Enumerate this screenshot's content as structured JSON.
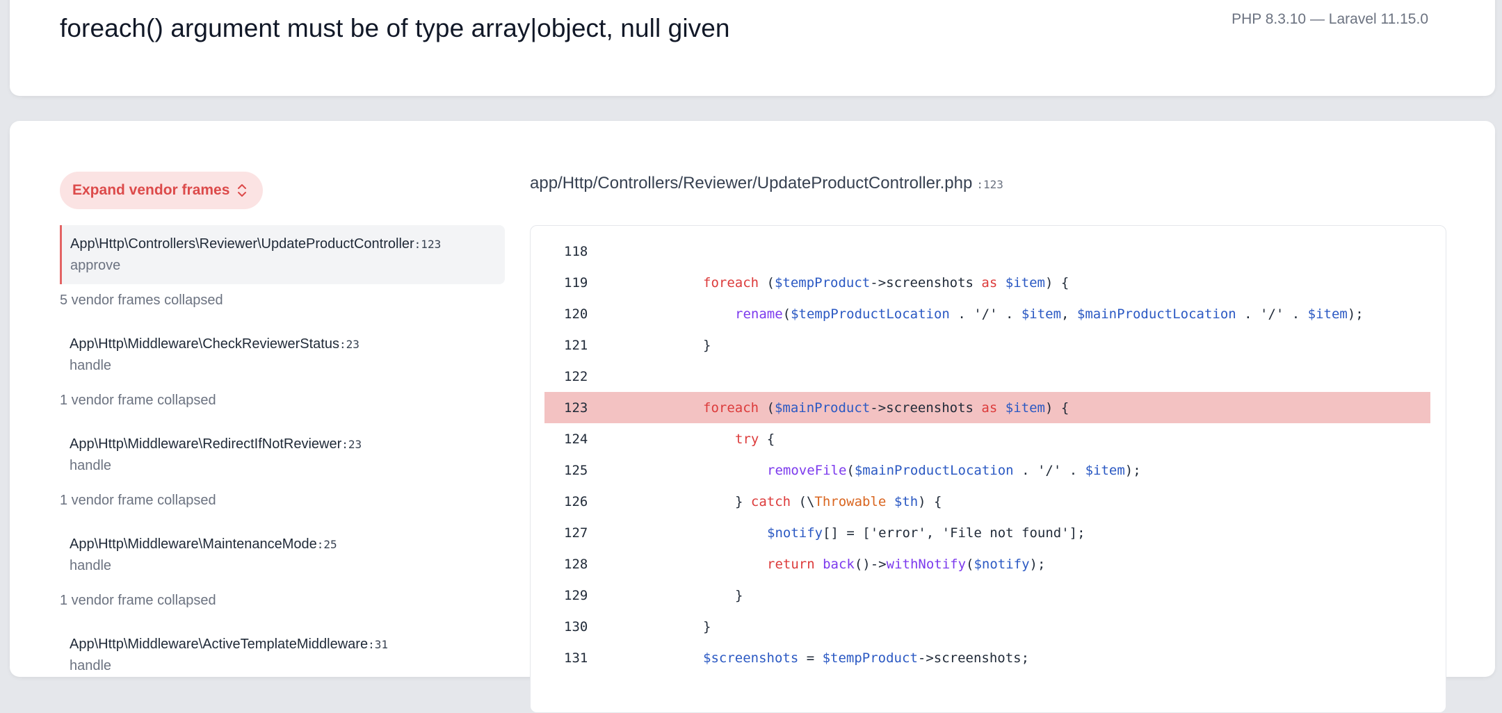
{
  "header": {
    "error_message": "foreach() argument must be of type array|object, null given",
    "version": "PHP 8.3.10 — Laravel 11.15.0"
  },
  "sidebar": {
    "expand_label": "Expand vendor frames",
    "frames": [
      {
        "class": "App\\Http\\Controllers\\Reviewer\\UpdateProductController",
        "line": ":123",
        "method": "approve",
        "active": true,
        "collapsed_after": "5 vendor frames collapsed"
      },
      {
        "class": "App\\Http\\Middleware\\CheckReviewerStatus",
        "line": ":23",
        "method": "handle",
        "collapsed_after": "1 vendor frame collapsed"
      },
      {
        "class": "App\\Http\\Middleware\\RedirectIfNotReviewer",
        "line": ":23",
        "method": "handle",
        "collapsed_after": "1 vendor frame collapsed"
      },
      {
        "class": "App\\Http\\Middleware\\MaintenanceMode",
        "line": ":25",
        "method": "handle",
        "collapsed_after": "1 vendor frame collapsed"
      },
      {
        "class": "App\\Http\\Middleware\\ActiveTemplateMiddleware",
        "line": ":31",
        "method": "handle"
      }
    ]
  },
  "editor": {
    "file_path": "app/Http/Controllers/Reviewer/UpdateProductController.php",
    "file_line": ":123",
    "highlight_line": "123",
    "lines": [
      {
        "num": "118",
        "indent": 0,
        "tokens": []
      },
      {
        "num": "119",
        "indent": 0,
        "tokens": [
          [
            "kw",
            "foreach"
          ],
          [
            "p",
            " ("
          ],
          [
            "var",
            "$tempProduct"
          ],
          [
            "p",
            "->screenshots "
          ],
          [
            "kw",
            "as"
          ],
          [
            "p",
            " "
          ],
          [
            "var",
            "$item"
          ],
          [
            "p",
            ") {"
          ]
        ]
      },
      {
        "num": "120",
        "indent": 1,
        "tokens": [
          [
            "fn",
            "rename"
          ],
          [
            "p",
            "("
          ],
          [
            "var",
            "$tempProductLocation"
          ],
          [
            "p",
            " . '/' . "
          ],
          [
            "var",
            "$item"
          ],
          [
            "p",
            ", "
          ],
          [
            "var",
            "$mainProductLocation"
          ],
          [
            "p",
            " . '/' . "
          ],
          [
            "var",
            "$item"
          ],
          [
            "p",
            ");"
          ]
        ]
      },
      {
        "num": "121",
        "indent": 0,
        "tokens": [
          [
            "p",
            "}"
          ]
        ]
      },
      {
        "num": "122",
        "indent": 0,
        "tokens": []
      },
      {
        "num": "123",
        "indent": 0,
        "tokens": [
          [
            "kw",
            "foreach"
          ],
          [
            "p",
            " ("
          ],
          [
            "var",
            "$mainProduct"
          ],
          [
            "p",
            "->screenshots "
          ],
          [
            "kw",
            "as"
          ],
          [
            "p",
            " "
          ],
          [
            "var",
            "$item"
          ],
          [
            "p",
            ") {"
          ]
        ]
      },
      {
        "num": "124",
        "indent": 1,
        "tokens": [
          [
            "kw",
            "try"
          ],
          [
            "p",
            " {"
          ]
        ]
      },
      {
        "num": "125",
        "indent": 2,
        "tokens": [
          [
            "fn",
            "removeFile"
          ],
          [
            "p",
            "("
          ],
          [
            "var",
            "$mainProductLocation"
          ],
          [
            "p",
            " . '/' . "
          ],
          [
            "var",
            "$item"
          ],
          [
            "p",
            ");"
          ]
        ]
      },
      {
        "num": "126",
        "indent": 1,
        "tokens": [
          [
            "p",
            "} "
          ],
          [
            "kw",
            "catch"
          ],
          [
            "p",
            " (\\"
          ],
          [
            "cls",
            "Throwable"
          ],
          [
            "p",
            " "
          ],
          [
            "var",
            "$th"
          ],
          [
            "p",
            ") {"
          ]
        ]
      },
      {
        "num": "127",
        "indent": 2,
        "tokens": [
          [
            "var",
            "$notify"
          ],
          [
            "p",
            "[] = ['error', 'File not found'];"
          ]
        ]
      },
      {
        "num": "128",
        "indent": 2,
        "tokens": [
          [
            "kw",
            "return"
          ],
          [
            "p",
            " "
          ],
          [
            "fn",
            "back"
          ],
          [
            "p",
            "()->"
          ],
          [
            "fn",
            "withNotify"
          ],
          [
            "p",
            "("
          ],
          [
            "var",
            "$notify"
          ],
          [
            "p",
            ");"
          ]
        ]
      },
      {
        "num": "129",
        "indent": 1,
        "tokens": [
          [
            "p",
            "}"
          ]
        ]
      },
      {
        "num": "130",
        "indent": 0,
        "tokens": [
          [
            "p",
            "}"
          ]
        ]
      },
      {
        "num": "131",
        "indent": 0,
        "tokens": [
          [
            "var",
            "$screenshots"
          ],
          [
            "p",
            " = "
          ],
          [
            "var",
            "$tempProduct"
          ],
          [
            "p",
            "->screenshots;"
          ]
        ]
      }
    ]
  },
  "colors": {
    "accent": "#dc4a4a",
    "highlight": "#f3c2c2"
  },
  "icons": {
    "expand": "chevron-up-down-icon"
  }
}
